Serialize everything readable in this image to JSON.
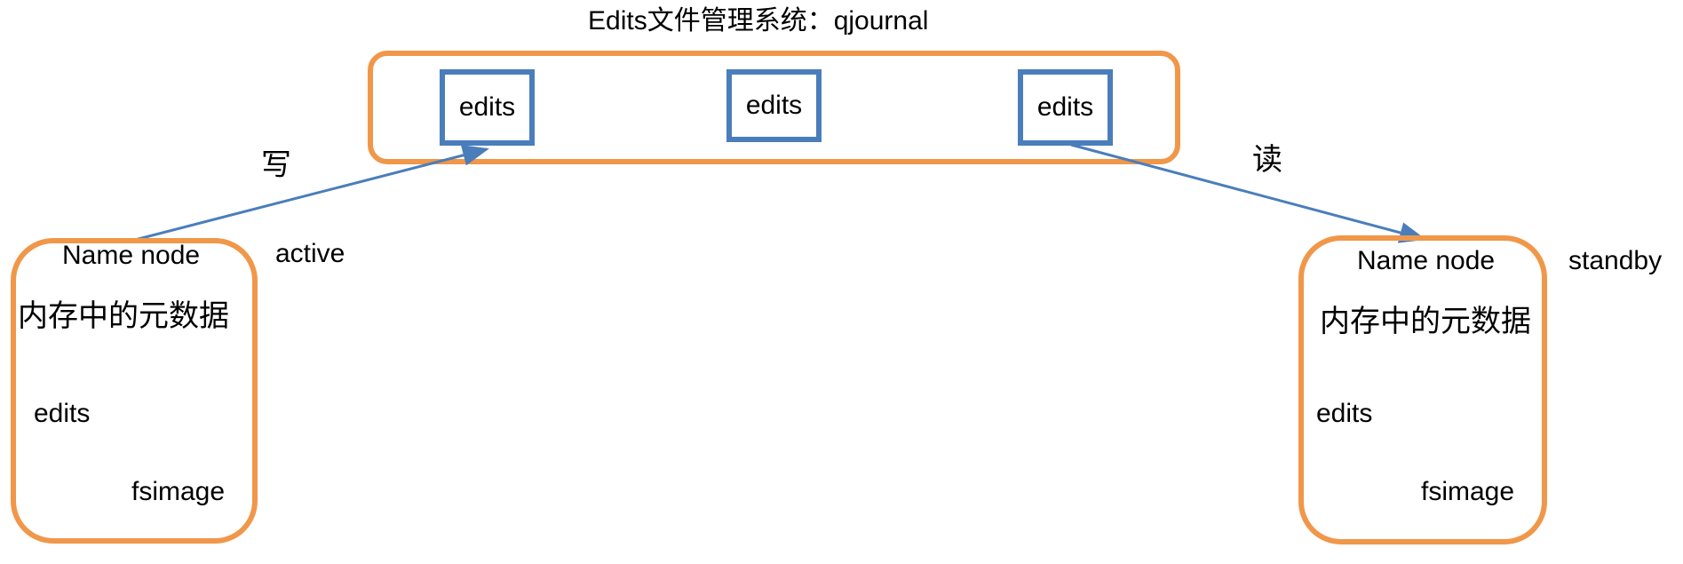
{
  "title": "Edits文件管理系统：qjournal",
  "journal": {
    "edits_boxes": [
      "edits",
      "edits",
      "edits"
    ]
  },
  "arrows": {
    "write_label": "写",
    "read_label": "读"
  },
  "namenodes": {
    "active": {
      "name": "Name node",
      "state": "active",
      "memory": "内存中的元数据",
      "edits": "edits",
      "fsimage": "fsimage"
    },
    "standby": {
      "name": "Name node",
      "state": "standby",
      "memory": "内存中的元数据",
      "edits": "edits",
      "fsimage": "fsimage"
    }
  },
  "colors": {
    "orange": "#F0974A",
    "blue": "#4A7EBB"
  }
}
